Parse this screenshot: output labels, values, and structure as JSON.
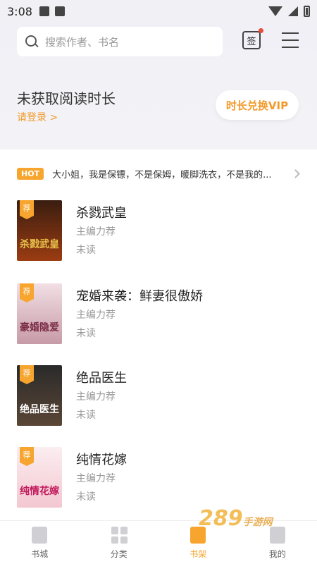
{
  "statusbar": {
    "time": "3:08"
  },
  "search": {
    "placeholder": "搜索作者、书名"
  },
  "header": {
    "signin_label": "签"
  },
  "reading": {
    "title": "未获取阅读时长",
    "login": "请登录 >",
    "vip_button": "时长兑换VIP"
  },
  "hot": {
    "badge": "HOT",
    "text": "大小姐，我是保镖，不是保姆，暖脚洗衣，不是我的..."
  },
  "books": [
    {
      "tag": "荐",
      "title": "杀戮武皇",
      "sub": "主编力荐",
      "status": "未读",
      "cover_text": "杀戮武皇",
      "colors": [
        "#3a1d10",
        "#9b3c12"
      ],
      "cover_fg": "#e8c24a"
    },
    {
      "tag": "荐",
      "title": "宠婚来袭：鲜妻很傲娇",
      "sub": "主编力荐",
      "status": "未读",
      "cover_text": "豪婚隐爱",
      "colors": [
        "#f1dfe4",
        "#c79aa8"
      ],
      "cover_fg": "#7a2c46"
    },
    {
      "tag": "荐",
      "title": "绝品医生",
      "sub": "主编力荐",
      "status": "未读",
      "cover_text": "绝品医生",
      "colors": [
        "#2a2a2a",
        "#5a4636"
      ],
      "cover_fg": "#ffffff"
    },
    {
      "tag": "荐",
      "title": "纯情花嫁",
      "sub": "主编力荐",
      "status": "未读",
      "cover_text": "纯情花嫁",
      "colors": [
        "#fbeef0",
        "#f3c7d1"
      ],
      "cover_fg": "#c2185b"
    }
  ],
  "tabs": [
    {
      "label": "书城",
      "icon": "book-icon"
    },
    {
      "label": "分类",
      "icon": "grid-icon"
    },
    {
      "label": "书架",
      "icon": "shelf-icon"
    },
    {
      "label": "我的",
      "icon": "user-icon"
    }
  ],
  "watermark": {
    "text": "289",
    "sub": "手游网"
  },
  "colors": {
    "accent": "#f7a52e",
    "link": "#f39a2b"
  }
}
